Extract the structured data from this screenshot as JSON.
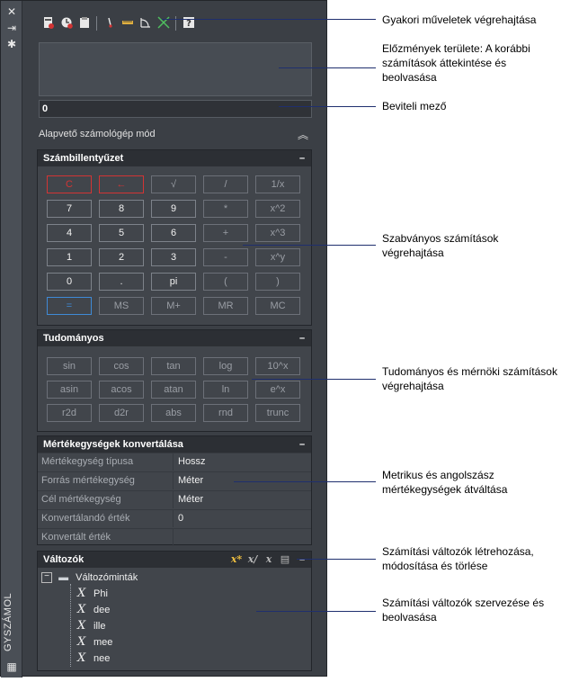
{
  "palette": {
    "title": "GYSZÁMOL"
  },
  "toolbar": {
    "icons": [
      "clear-icon",
      "history-clear-icon",
      "paste-icon",
      "get-coordinates-icon",
      "distance-icon",
      "angle-icon",
      "intersection-icon",
      "help-icon"
    ]
  },
  "input": {
    "value": "0"
  },
  "mode": {
    "label": "Alapvető számológép mód"
  },
  "keypad": {
    "title": "Számbillentyűzet",
    "rows": [
      [
        "C",
        "←",
        "√",
        "/",
        "1/x"
      ],
      [
        "7",
        "8",
        "9",
        "*",
        "x^2"
      ],
      [
        "4",
        "5",
        "6",
        "+",
        "x^3"
      ],
      [
        "1",
        "2",
        "3",
        "-",
        "x^y"
      ],
      [
        "0",
        ".",
        "pi",
        "(",
        ")"
      ],
      [
        "=",
        "MS",
        "M+",
        "MR",
        "MC"
      ]
    ]
  },
  "scientific": {
    "title": "Tudományos",
    "rows": [
      [
        "sin",
        "cos",
        "tan",
        "log",
        "10^x"
      ],
      [
        "asin",
        "acos",
        "atan",
        "ln",
        "e^x"
      ],
      [
        "r2d",
        "d2r",
        "abs",
        "rnd",
        "trunc"
      ]
    ]
  },
  "units": {
    "title": "Mértékegységek konvertálása",
    "rows": [
      {
        "name": "Mértékegység típusa",
        "value": "Hossz"
      },
      {
        "name": "Forrás mértékegység",
        "value": "Méter"
      },
      {
        "name": "Cél mértékegység",
        "value": "Méter"
      },
      {
        "name": "Konvertálandó érték",
        "value": "0"
      },
      {
        "name": "Konvertált érték",
        "value": ""
      }
    ]
  },
  "variables": {
    "title": "Változók",
    "group": "Változóminták",
    "items": [
      "Phi",
      "dee",
      "ille",
      "mee",
      "nee"
    ]
  },
  "callouts": [
    {
      "text": "Gyakori műveletek végrehajtása"
    },
    {
      "text": "Előzmények területe: A korábbi számítások áttekintése és beolvasása"
    },
    {
      "text": "Beviteli mező"
    },
    {
      "text": "Szabványos számítások végrehajtása"
    },
    {
      "text": "Tudományos és mérnöki számítások végrehajtása"
    },
    {
      "text": "Metrikus és angolszász mértékegységek átváltása"
    },
    {
      "text": "Számítási változók létrehozása, módosítása és törlése"
    },
    {
      "text": "Számítási változók szervezése és beolvasása"
    }
  ]
}
